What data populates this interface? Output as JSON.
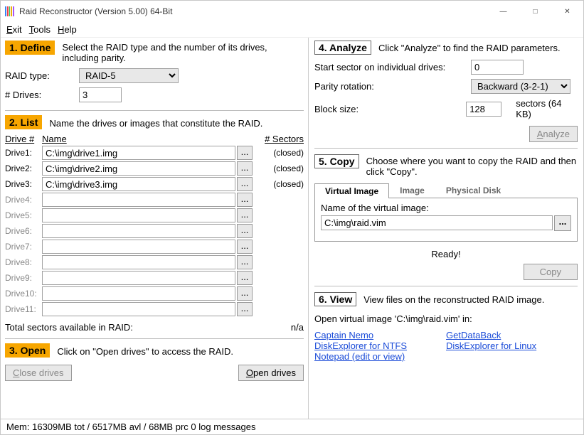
{
  "window": {
    "title": "Raid Reconstructor (Version 5.00) 64-Bit"
  },
  "menu": {
    "exit": "Exit",
    "tools": "Tools",
    "help": "Help"
  },
  "s1": {
    "num": "1. Define",
    "desc": "Select the RAID type and the number of its drives, including parity.",
    "raid_type_label": "RAID type:",
    "raid_type_value": "RAID-5",
    "drives_label": "# Drives:",
    "drives_value": "3"
  },
  "s2": {
    "num": "2. List",
    "desc": "Name the drives or images that constitute the RAID.",
    "col_drive": "Drive #",
    "col_name": "Name",
    "col_sectors": "# Sectors",
    "drives": [
      {
        "label": "Drive1:",
        "value": "C:\\img\\drive1.img",
        "status": "(closed)",
        "dim": false
      },
      {
        "label": "Drive2:",
        "value": "C:\\img\\drive2.img",
        "status": "(closed)",
        "dim": false
      },
      {
        "label": "Drive3:",
        "value": "C:\\img\\drive3.img",
        "status": "(closed)",
        "dim": false
      },
      {
        "label": "Drive4:",
        "value": "",
        "status": "",
        "dim": true
      },
      {
        "label": "Drive5:",
        "value": "",
        "status": "",
        "dim": true
      },
      {
        "label": "Drive6:",
        "value": "",
        "status": "",
        "dim": true
      },
      {
        "label": "Drive7:",
        "value": "",
        "status": "",
        "dim": true
      },
      {
        "label": "Drive8:",
        "value": "",
        "status": "",
        "dim": true
      },
      {
        "label": "Drive9:",
        "value": "",
        "status": "",
        "dim": true
      },
      {
        "label": "Drive10:",
        "value": "",
        "status": "",
        "dim": true
      },
      {
        "label": "Drive11:",
        "value": "",
        "status": "",
        "dim": true
      }
    ],
    "total_label": "Total sectors available in RAID:",
    "total_value": "n/a"
  },
  "s3": {
    "num": "3. Open",
    "desc": "Click on \"Open drives\" to access the RAID.",
    "close_btn": "Close drives",
    "open_btn": "Open drives"
  },
  "s4": {
    "num": "4. Analyze",
    "desc": "Click \"Analyze\" to find the RAID parameters.",
    "start_sector_label": "Start sector on individual drives:",
    "start_sector_value": "0",
    "parity_label": "Parity rotation:",
    "parity_value": "Backward (3-2-1)",
    "block_label": "Block size:",
    "block_value": "128",
    "block_suffix": "sectors (64 KB)",
    "analyze_btn": "Analyze"
  },
  "s5": {
    "num": "5. Copy",
    "desc": "Choose where you want to copy the RAID and then click \"Copy\".",
    "tab_virtual": "Virtual Image",
    "tab_image": "Image",
    "tab_physical": "Physical Disk",
    "vim_label": "Name of the virtual image:",
    "vim_value": "C:\\img\\raid.vim",
    "ready": "Ready!",
    "copy_btn": "Copy"
  },
  "s6": {
    "num": "6. View",
    "desc": "View files on the reconstructed RAID image.",
    "open_in": "Open virtual image 'C:\\img\\raid.vim' in:",
    "links": {
      "captain_nemo": "Captain Nemo",
      "de_ntfs": "DiskExplorer for NTFS",
      "notepad": "Notepad (edit or view)",
      "getdataback": "GetDataBack",
      "de_linux": "DiskExplorer for Linux"
    }
  },
  "statusbar": {
    "text": "Mem: 16309MB tot / 6517MB avl / 68MB prc  0 log messages"
  }
}
